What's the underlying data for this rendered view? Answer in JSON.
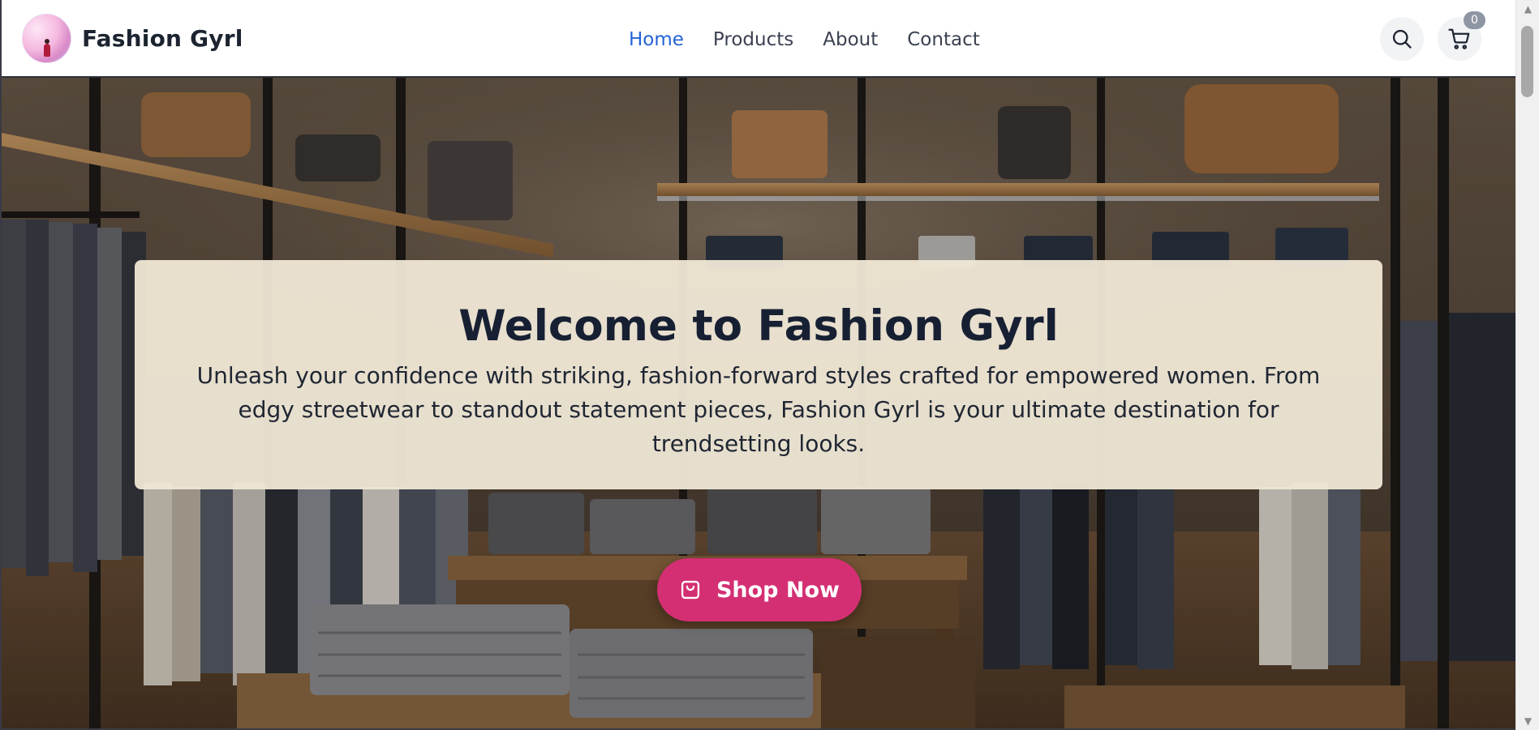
{
  "header": {
    "brand_name": "Fashion Gyrl",
    "logo_icon": "brand-logo-avatar",
    "nav": [
      {
        "label": "Home",
        "active": true
      },
      {
        "label": "Products",
        "active": false
      },
      {
        "label": "About",
        "active": false
      },
      {
        "label": "Contact",
        "active": false
      }
    ],
    "search_icon": "search-icon",
    "cart_icon": "cart-icon",
    "cart_count": "0"
  },
  "hero": {
    "title": "Welcome to Fashion Gyrl",
    "description": "Unleash your confidence with striking, fashion-forward styles crafted for empowered women. From edgy streetwear to standout statement pieces, Fashion Gyrl is your ultimate destination for trendsetting looks.",
    "cta_label": "Shop Now",
    "cta_icon": "shopping-bag-icon",
    "background": "clothing-store-interior"
  },
  "colors": {
    "nav_active": "#2563d6",
    "cta_background": "#d42f73",
    "title_text": "#172033"
  }
}
